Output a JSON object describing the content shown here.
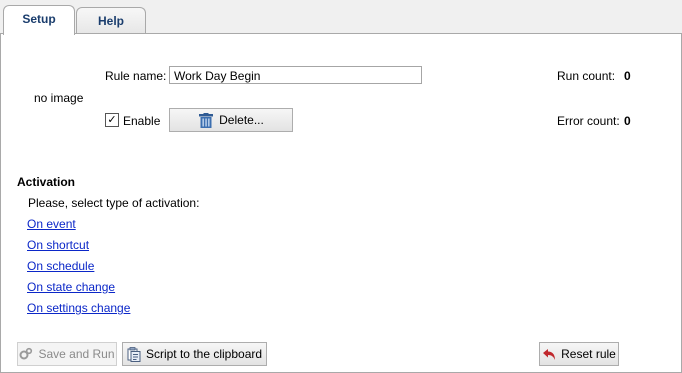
{
  "tabs": [
    {
      "label": "Setup",
      "active": true
    },
    {
      "label": "Help",
      "active": false
    }
  ],
  "image_placeholder": "no image",
  "rule": {
    "name_label": "Rule name:",
    "name_value": "Work Day Begin",
    "enable_label": "Enable",
    "enabled": true,
    "delete_label": "Delete..."
  },
  "stats": {
    "run_label": "Run count:",
    "run_value": "0",
    "error_label": "Error count:",
    "error_value": "0"
  },
  "activation": {
    "heading": "Activation",
    "prompt": "Please, select type of activation:",
    "options": [
      "On event",
      "On shortcut",
      "On schedule",
      "On state change",
      "On settings change"
    ]
  },
  "footer": {
    "save_label": "Save and Run",
    "script_label": "Script to the clipboard",
    "reset_label": "Reset rule"
  },
  "colors": {
    "link": "#0b27c8",
    "tab_text": "#1a3d6d",
    "reset_arrow": "#c0282d"
  }
}
